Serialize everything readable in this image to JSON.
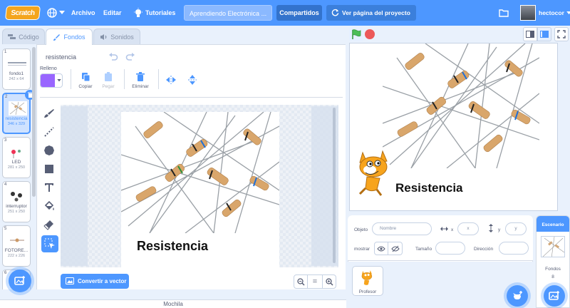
{
  "menubar": {
    "logo": "Scratch",
    "archivo": "Archivo",
    "editar": "Editar",
    "tutoriales": "Tutoriales",
    "project_title": "Aprendiendo Electrónica ...",
    "compartidos": "Compartidos",
    "ver_pagina": "Ver página del proyecto",
    "username": "hectocor"
  },
  "tabs": {
    "codigo": "Código",
    "fondos": "Fondos",
    "sonidos": "Sonidos"
  },
  "costumes": [
    {
      "num": "1",
      "name": "fondo1",
      "size": "242 x 64"
    },
    {
      "num": "2",
      "name": "resistencia",
      "size": "346 x 329"
    },
    {
      "num": "3",
      "name": "LED",
      "size": "281 x 250"
    },
    {
      "num": "4",
      "name": "interruptor",
      "size": "251 x 250"
    },
    {
      "num": "5",
      "name": "FOTORE...",
      "size": "222 x 226"
    },
    {
      "num": "6",
      "name": "",
      "size": ""
    }
  ],
  "editor": {
    "costume_name": "resistencia",
    "fill_label": "Relleno",
    "fill_color": "#9966ff",
    "copy": "Copiar",
    "paste": "Pegar",
    "delete": "Eliminar",
    "convert": "Convertir a vector",
    "canvas_text": "Resistencia",
    "zoom_out": "−",
    "zoom_reset": "=",
    "zoom_in": "+"
  },
  "mochila": "Mochila",
  "stage": {
    "text": "Resistencia"
  },
  "sprite_info": {
    "objeto_label": "Objeto",
    "objeto_placeholder": "Nombre",
    "x_label": "x",
    "x_placeholder": "x",
    "y_label": "y",
    "y_placeholder": "y",
    "mostrar_label": "mostrar",
    "tamano_label": "Tamaño",
    "direccion_label": "Dirección"
  },
  "sprites": [
    {
      "name": "Profesor"
    }
  ],
  "stage_pane": {
    "title": "Escenario",
    "fondos_label": "Fondos",
    "fondos_count": "8"
  },
  "colors": {
    "accent": "#4d97ff",
    "flag": "#4cbf56",
    "stop": "#ec5959",
    "logo": "#f4a51d"
  }
}
